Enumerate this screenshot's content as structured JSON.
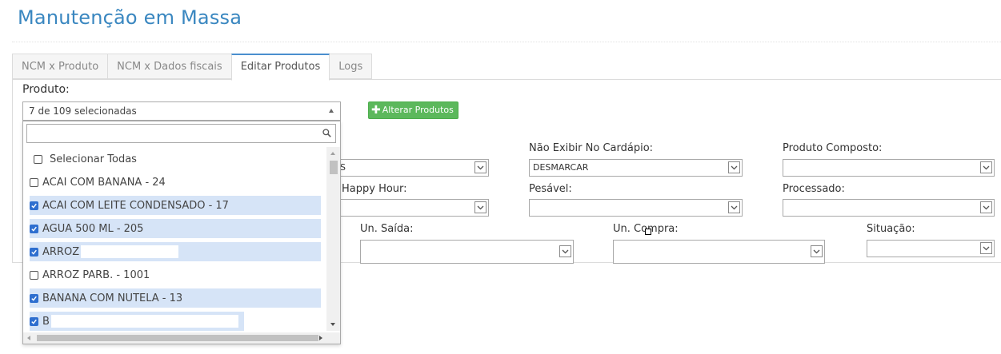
{
  "page": {
    "title": "Manutenção em Massa"
  },
  "tabs": [
    {
      "label": "NCM x Produto",
      "active": false
    },
    {
      "label": "NCM x Dados fiscais",
      "active": false
    },
    {
      "label": "Editar Produtos",
      "active": true
    },
    {
      "label": "Logs",
      "active": false
    }
  ],
  "product": {
    "label": "Produto:",
    "summary": "7 de 109 selecionadas",
    "search_value": "",
    "select_all_label": "Selecionar Todas",
    "items": [
      {
        "label": "ACAI COM BANANA - 24",
        "checked": false
      },
      {
        "label": "ACAI COM LEITE CONDENSADO - 17",
        "checked": true
      },
      {
        "label": "AGUA 500 ML - 205",
        "checked": true
      },
      {
        "label": "ARROZ",
        "checked": true
      },
      {
        "label": "ARROZ PARB. - 1001",
        "checked": false
      },
      {
        "label": "BANANA COM NUTELA - 13",
        "checked": true
      },
      {
        "label": "B",
        "checked": true
      }
    ]
  },
  "actions": {
    "alter_label": "Alterar Produtos"
  },
  "fields": {
    "first_select_value": "S",
    "nao_exibir": {
      "label": "Não Exibir No Cardápio:",
      "value": "DESMARCAR"
    },
    "produto_composto": {
      "label": "Produto Composto:",
      "value": ""
    },
    "happy_hour": {
      "label": "Happy Hour:",
      "value": ""
    },
    "pesavel": {
      "label": "Pesável:",
      "value": ""
    },
    "processado": {
      "label": "Processado:",
      "value": ""
    },
    "un_saida": {
      "label": "Un. Saída:",
      "value": ""
    },
    "un_compra": {
      "label": "Un. Compra:",
      "value": ""
    },
    "situacao": {
      "label": "Situação:",
      "value": ""
    }
  },
  "colors": {
    "title": "#3a87c0",
    "button": "#5cb85c",
    "selected_row": "#d6e4f7",
    "checkbox_on": "#2f6fcf"
  }
}
